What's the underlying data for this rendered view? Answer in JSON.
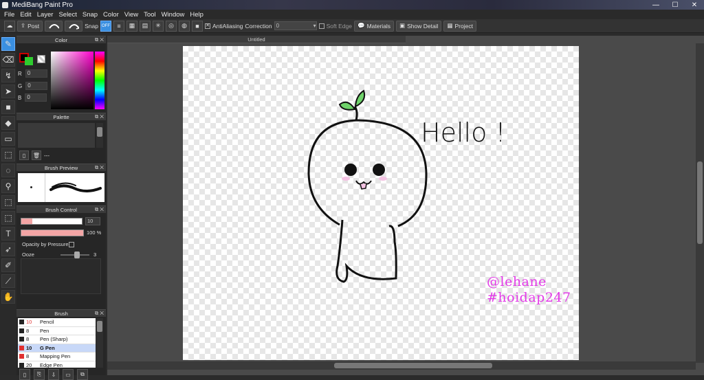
{
  "window": {
    "title": "MediBang Paint Pro",
    "minimize": "—",
    "maximize": "☐",
    "close": "✕"
  },
  "menu": [
    "File",
    "Edit",
    "Layer",
    "Select",
    "Snap",
    "Color",
    "View",
    "Tool",
    "Window",
    "Help"
  ],
  "toolbar": {
    "post_label": "Post",
    "snap_label": "Snap",
    "snap_off": "OFF",
    "antialiasing_label": "AntiAliasing",
    "correction_label": "Correction",
    "correction_value": "0",
    "soft_edge_label": "Soft Edge",
    "materials_label": "Materials",
    "show_detail_label": "Show Detail",
    "project_label": "Project"
  },
  "color_panel": {
    "title": "Color",
    "r_label": "R",
    "r_value": "0",
    "g_label": "G",
    "g_value": "0",
    "b_label": "B",
    "b_value": "0",
    "foreground_color": "#000000",
    "background_color": "#2ecc2e"
  },
  "palette_panel": {
    "title": "Palette",
    "separator": "---"
  },
  "brush_preview_panel": {
    "title": "Brush Preview"
  },
  "brush_control_panel": {
    "title": "Brush Control",
    "size_value": "10",
    "opacity_value": "100",
    "opacity_unit": "%",
    "opacity_by_pressure_label": "Opacity by Pressure",
    "ooze_label": "Ooze",
    "ooze_value": "3"
  },
  "brush_panel": {
    "title": "Brush",
    "items": [
      {
        "size": "10",
        "name": "Pencil",
        "color": "#222222",
        "selected": false
      },
      {
        "size": "8",
        "name": "Pen",
        "color": "#222222",
        "selected": false
      },
      {
        "size": "8",
        "name": "Pen (Sharp)",
        "color": "#222222",
        "selected": false
      },
      {
        "size": "10",
        "name": "G Pen",
        "color": "#e03030",
        "selected": true
      },
      {
        "size": "8",
        "name": "Mapping Pen",
        "color": "#e03030",
        "selected": false
      },
      {
        "size": "20",
        "name": "Edge Pen",
        "color": "#222222",
        "selected": false
      }
    ]
  },
  "document": {
    "tab_title": "Untitled",
    "hello_text": "Hello !",
    "watermark_line1": "@lehane",
    "watermark_line2": "#hoidap247",
    "accent_color": "#e33ae8"
  },
  "tools": [
    "pen-tool-icon",
    "eraser-icon",
    "fill-brush-icon",
    "select-move-icon",
    "rectangle-fill-icon",
    "bucket-icon",
    "gradient-icon",
    "select-rect-icon",
    "lasso-icon",
    "magic-wand-icon",
    "select-pen-icon",
    "select-eraser-icon",
    "text-icon",
    "operation-icon",
    "divide-icon",
    "eyedropper-icon",
    "hand-icon"
  ]
}
